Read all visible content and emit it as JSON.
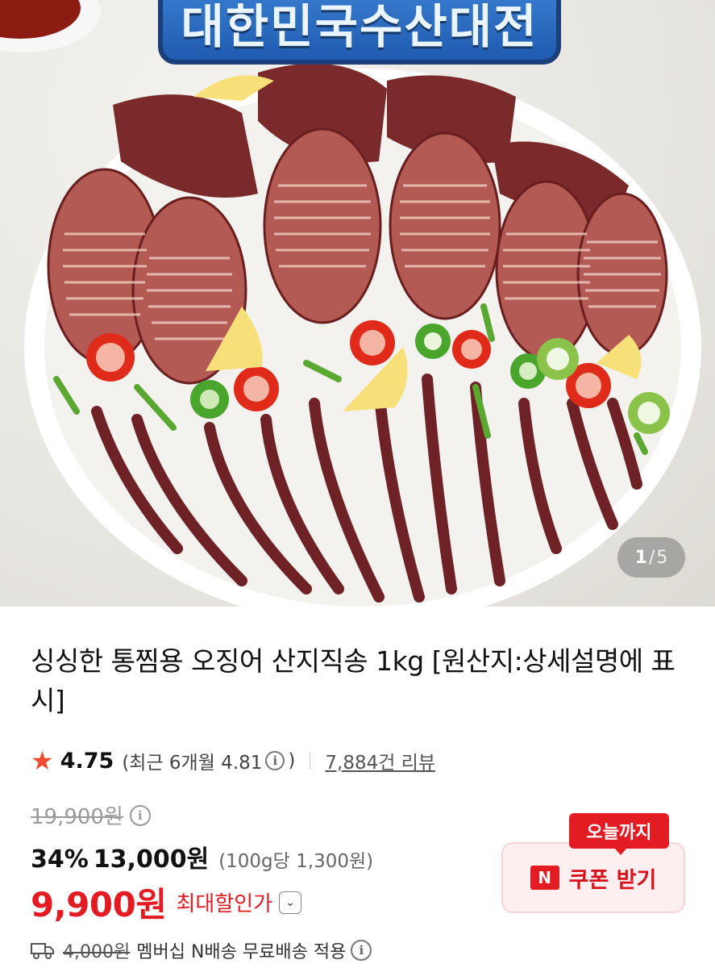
{
  "hero": {
    "banner_text": "대한민국수산대전",
    "image_counter": {
      "current": "1",
      "separator": "/",
      "total": "5"
    }
  },
  "product": {
    "title": "싱싱한 통찜용 오징어 산지직송 1kg [원산지:상세설명에 표시]",
    "rating": "4.75",
    "recent_rating_prefix": "(최근 6개월 4.81",
    "recent_rating_suffix": ")",
    "review_count": "7,884건 리뷰",
    "original_price": "19,900원",
    "discount_percent": "34%",
    "discount_price": "13,000원",
    "unit_price": "(100g당 1,300원)",
    "final_price": "9,900원",
    "final_price_label": "최대할인가",
    "shipping_original": "4,000원",
    "shipping_text": "멤버십 N배송 무료배송 적용"
  },
  "coupon": {
    "tag": "오늘까지",
    "badge": "N",
    "button_label": "쿠폰 받기"
  },
  "colors": {
    "accent_red": "#e31b23",
    "star": "#f04b2b",
    "coupon_bg": "#fdeff0"
  }
}
